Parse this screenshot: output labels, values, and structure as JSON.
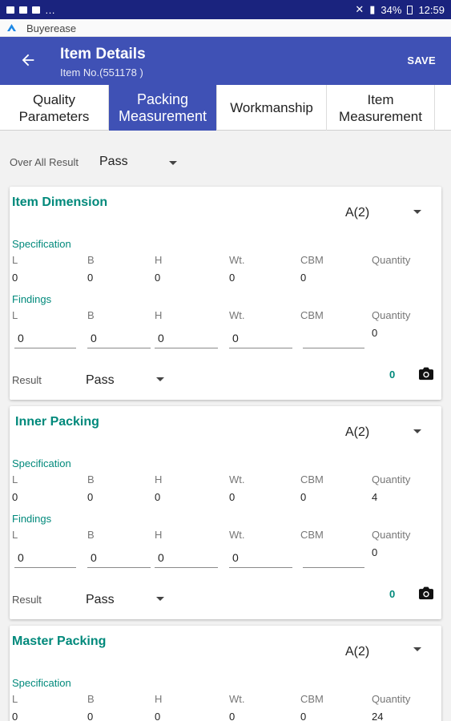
{
  "status_bar": {
    "battery": "34%",
    "time": "12:59"
  },
  "app": {
    "name": "Buyerease"
  },
  "toolbar": {
    "title": "Item Details",
    "subtitle": "Item No.(551178 )",
    "save_label": "SAVE"
  },
  "tabs": [
    {
      "label": "Quality\nParameters",
      "active": false
    },
    {
      "label": "Packing\nMeasurement",
      "active": true
    },
    {
      "label": "Workmanship",
      "active": false
    },
    {
      "label": "Item\nMeasurement",
      "active": false
    }
  ],
  "overall": {
    "label": "Over All Result",
    "value": "Pass"
  },
  "columns": [
    "L",
    "B",
    "H",
    "Wt.",
    "CBM",
    "Quantity"
  ],
  "labels": {
    "specification": "Specification",
    "findings": "Findings",
    "result": "Result"
  },
  "cards": [
    {
      "title": "Item Dimension",
      "grade": "A(2)",
      "spec": [
        "0",
        "0",
        "0",
        "0",
        "0",
        ""
      ],
      "findings": [
        "0",
        "0",
        "0",
        "0",
        "",
        "0"
      ],
      "result": "Pass",
      "photo_count": "0"
    },
    {
      "title": "Inner Packing",
      "grade": "A(2)",
      "spec": [
        "0",
        "0",
        "0",
        "0",
        "0",
        "4"
      ],
      "findings": [
        "0",
        "0",
        "0",
        "0",
        "",
        "0"
      ],
      "result": "Pass",
      "photo_count": "0"
    },
    {
      "title": "Master Packing",
      "grade": "A(2)",
      "spec": [
        "0",
        "0",
        "0",
        "0",
        "0",
        "24"
      ]
    }
  ],
  "colors": {
    "primary": "#3f51b5",
    "status_bar": "#1a237e",
    "accent": "#00897b"
  },
  "icons": [
    "back-arrow-icon",
    "camera-icon",
    "dropdown-caret-icon"
  ]
}
